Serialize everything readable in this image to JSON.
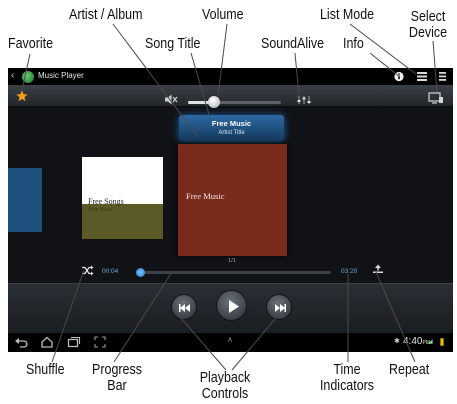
{
  "callouts": {
    "artist_album": "Artist / Album",
    "volume": "Volume",
    "list_mode": "List Mode",
    "select": "Select",
    "device": "Device",
    "favorite": "Favorite",
    "song_title": "Song Title",
    "soundalive": "SoundAlive",
    "info": "Info",
    "shuffle": "Shuffle",
    "progress": "Progress",
    "bar": "Bar",
    "playback": "Playback",
    "controls": "Controls",
    "time": "Time",
    "indicators": "Indicators",
    "repeat": "Repeat"
  },
  "player": {
    "app_title": "Music Player",
    "now_playing_title": "Free Music",
    "now_playing_artist": "Artist Title",
    "album_prev_name": "Free Songs",
    "album_prev_sub": "Free Music",
    "album_current_name": "Free Music",
    "track_count": "1/1",
    "elapsed": "00:04",
    "total": "03:20",
    "volume_level": 0.28,
    "progress_level": 0.02
  },
  "status_bar": {
    "clock": "4:40",
    "ampm": "PM"
  },
  "icons": {
    "favorite": "star-icon",
    "mute": "speaker-icon",
    "soundalive": "equalizer-icon",
    "info": "info-icon",
    "list_mode": "list-icon",
    "select_device": "device-icon",
    "shuffle": "shuffle-icon",
    "repeat": "repeat-icon",
    "previous": "previous-icon",
    "play": "play-icon",
    "next": "next-icon"
  },
  "colors": {
    "accent": "#2d6aa4",
    "favorite": "#f4a01a",
    "time_text": "#6fa9d8"
  }
}
